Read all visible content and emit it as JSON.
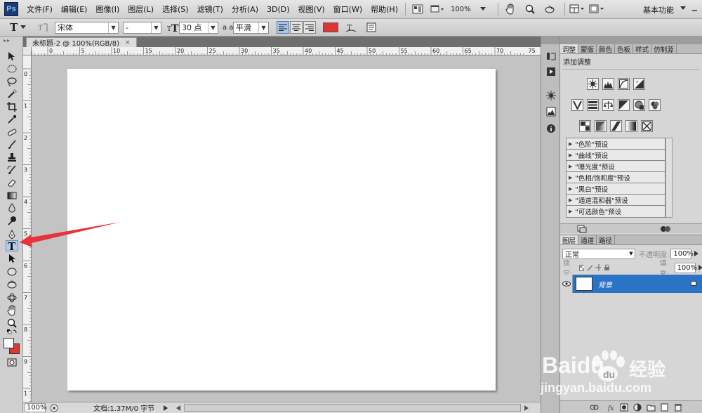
{
  "app": {
    "logo": "Ps"
  },
  "menu": [
    "文件(F)",
    "编辑(E)",
    "图像(I)",
    "图层(L)",
    "选择(S)",
    "滤镜(T)",
    "分析(A)",
    "3D(D)",
    "视图(V)",
    "窗口(W)",
    "帮助(H)"
  ],
  "menubar": {
    "zoom": "100%",
    "workspace": "基本功能"
  },
  "options": {
    "tool_glyph": "T",
    "font_family": "宋体",
    "font_style": "-",
    "font_size": "30 点",
    "antialias_label": "a a",
    "antialias": "平滑",
    "text_color": "#e03535"
  },
  "document": {
    "tab_title": "未标题-2 @ 100%(RGB/8)",
    "close": "×",
    "ruler_top": [
      "5",
      "0",
      "5",
      "10",
      "15",
      "20",
      "25",
      "30",
      "35",
      "40",
      "45",
      "50",
      "55",
      "60",
      "65",
      "70",
      "75",
      "80",
      "85",
      "90",
      "95",
      "100",
      "105"
    ],
    "ruler_left": [
      "0",
      "1",
      "2",
      "3",
      "4",
      "5",
      "6",
      "7",
      "8",
      "9",
      "1"
    ],
    "status_zoom": "100%",
    "status_info": "文档:1.37M/0 字节"
  },
  "adjustments": {
    "tabs": [
      "调整",
      "蒙版",
      "颜色",
      "色板",
      "样式",
      "仿制源"
    ],
    "title": "添加调整",
    "presets": [
      "\"色阶\"预设",
      "\"曲线\"预设",
      "\"曝光度\"预设",
      "\"色相/饱和度\"预设",
      "\"黑白\"预设",
      "\"通道混和器\"预设",
      "\"可选颜色\"预设"
    ]
  },
  "layers": {
    "tabs": [
      "图层",
      "通道",
      "路径"
    ],
    "blend_mode": "正常",
    "opacity_label": "不透明度:",
    "opacity": "100%",
    "lock_label": "锁定:",
    "fill_label": "填充:",
    "fill": "100%",
    "items": [
      {
        "name": "背景"
      }
    ]
  },
  "watermark": {
    "brand": "Baidu",
    "brand_cn": "经验",
    "url": "jingyan.baidu.com"
  },
  "colors": {
    "arrow": "#e8323c",
    "selection": "#2b73c4",
    "canvas_bg": "#ffffff"
  }
}
